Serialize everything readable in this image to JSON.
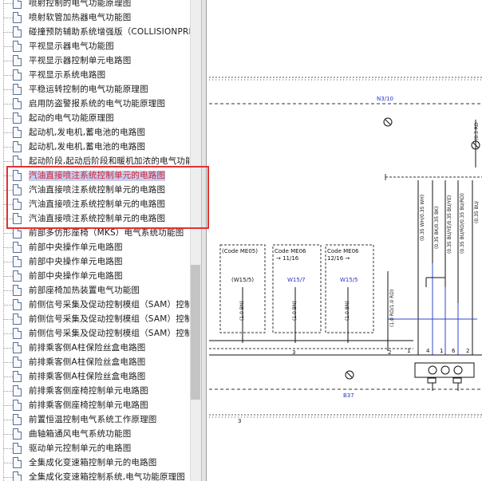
{
  "tree": {
    "items": [
      {
        "label": "喷射控制的电气功能原理图"
      },
      {
        "label": "喷射软管加热器电气功能图"
      },
      {
        "label": "碰撞预防辅助系统增强版（COLLISIONPREVENTION"
      },
      {
        "label": "平视显示器电气功能图"
      },
      {
        "label": "平视显示器控制单元电路图"
      },
      {
        "label": "平视显示系统电路图"
      },
      {
        "label": "平稳运转控制的电气功能原理图"
      },
      {
        "label": "启用防盗警报系统的电气功能原理图"
      },
      {
        "label": "起动的电气功能原理图"
      },
      {
        "label": "起动机,发电机,蓄电池的电路图"
      },
      {
        "label": "起动机,发电机,蓄电池的电路图"
      },
      {
        "label": "起动阶段,起动后阶段和暖机加浓的电气功能原理图"
      },
      {
        "label": "汽油直接喷注系统控制单元的电路图",
        "selected": true
      },
      {
        "label": "汽油直接喷注系统控制单元的电路图"
      },
      {
        "label": "汽油直接喷注系统控制单元的电路图"
      },
      {
        "label": "汽油直接喷注系统控制单元的电路图"
      },
      {
        "label": "前部多仿形座椅（MKS）电气系统功能图"
      },
      {
        "label": "前部中央操作单元电路图"
      },
      {
        "label": "前部中央操作单元电路图"
      },
      {
        "label": "前部中央操作单元电路图"
      },
      {
        "label": "前部座椅加热装置电气功能图"
      },
      {
        "label": "前侧信号采集及促动控制模组（SAM）控制单元"
      },
      {
        "label": "前侧信号采集及促动控制模组（SAM）控制单元"
      },
      {
        "label": "前侧信号采集及促动控制模组（SAM）控制单元"
      },
      {
        "label": "前排乘客侧A柱保险丝盒电路图"
      },
      {
        "label": "前排乘客侧A柱保险丝盒电路图"
      },
      {
        "label": "前排乘客侧A柱保险丝盒电路图"
      },
      {
        "label": "前排乘客侧座椅控制单元电路图"
      },
      {
        "label": "前排乘客侧座椅控制单元电路图"
      },
      {
        "label": "前置恒温控制电气系统工作原理图"
      },
      {
        "label": "曲轴箱通风电气系统功能图"
      },
      {
        "label": "驱动单元控制单元的电路图"
      },
      {
        "label": "全集成化变速箱控制单元的电路图"
      },
      {
        "label": "全集成化变速箱控制系统,电气功能原理图"
      }
    ]
  },
  "scrollbar": {
    "thumb_position": 0.55,
    "thumb_size": 0.28
  },
  "diagram": {
    "component_top": "N3/10",
    "component_bottom": "B37",
    "codes": [
      {
        "code": "(Code ME05)",
        "ref": "",
        "wire": "(W15/5)",
        "wire_color": "(1.0 BN)"
      },
      {
        "code": "Code ME06",
        "ref": "→ 11/16",
        "wire": "W15/7",
        "wire_color": "(1.0 BN)"
      },
      {
        "code": "Code ME06",
        "ref": "12/16 →",
        "wire": "W15/5",
        "wire_color": "(1.0 BN)"
      }
    ],
    "wire_single": "(1.0 RD/1.0 RD)",
    "wires_vertical": [
      "(0.35 WH/0.35 WH)",
      "(0.35 BK/0.35 BK)",
      "(0.35 BU/YE/0.35 BU/YE)",
      "(0.35 BU/RD/0.35 BU/RD)",
      "(0.35 BU/"
    ],
    "pins": [
      "1",
      "3",
      "4",
      "5",
      "6",
      "2",
      "3",
      "2",
      "1"
    ],
    "side_label": "(0.5 RD",
    "colors": {
      "wire_blue": "#2233cc",
      "line": "#111111",
      "dash": "#333333"
    }
  },
  "annotation": {
    "highlight_color": "#e23232"
  }
}
